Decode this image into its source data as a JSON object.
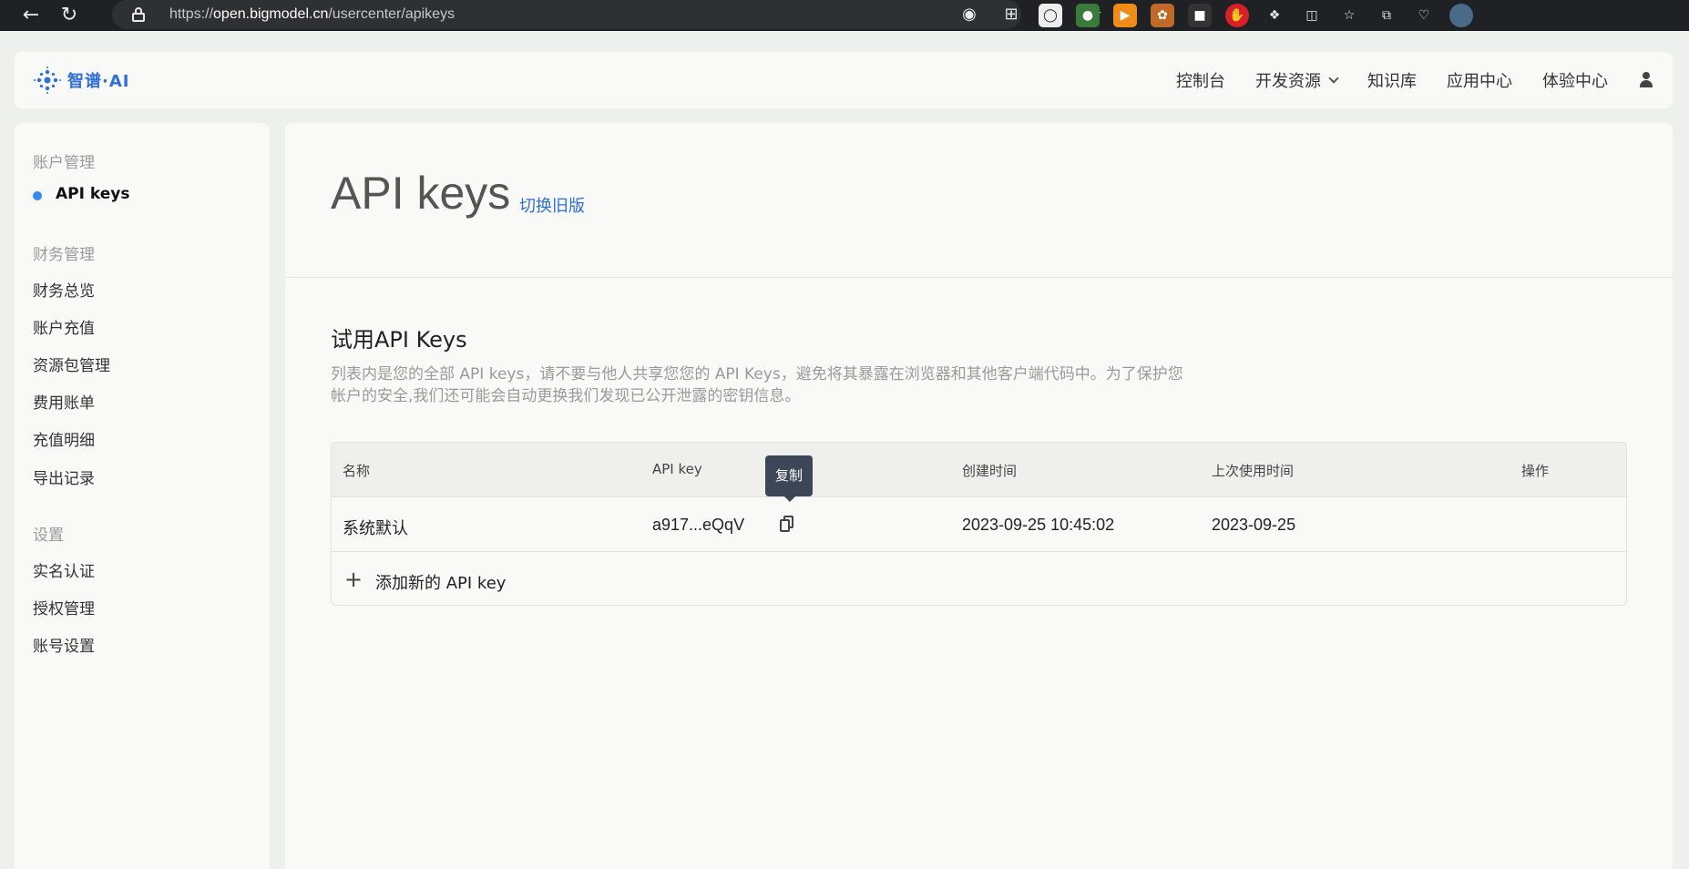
{
  "browser": {
    "url_prefix": "https://",
    "url_host": "open.bigmodel.cn",
    "url_path": "/usercenter/apikeys"
  },
  "header": {
    "logo_text": "智谱·AI",
    "nav": [
      {
        "label": "控制台"
      },
      {
        "label": "开发资源"
      },
      {
        "label": "知识库"
      },
      {
        "label": "应用中心"
      },
      {
        "label": "体验中心"
      }
    ]
  },
  "sidebar": {
    "groups": [
      {
        "title": "账户管理",
        "items": [
          "API keys"
        ]
      },
      {
        "title": "财务管理",
        "items": [
          "财务总览",
          "账户充值",
          "资源包管理",
          "费用账单",
          "充值明细",
          "导出记录"
        ]
      },
      {
        "title": "设置",
        "items": [
          "实名认证",
          "授权管理",
          "账号设置"
        ]
      }
    ]
  },
  "main": {
    "title": "API keys",
    "switch_link": "切换旧版",
    "section_title": "试用API Keys",
    "section_desc": "列表内是您的全部 API keys，请不要与他人共享您您的 API Keys，避免将其暴露在浏览器和其他客户端代码中。为了保护您帐户的安全,我们还可能会自动更换我们发现已公开泄露的密钥信息。",
    "table": {
      "headers": [
        "名称",
        "API key",
        "创建时间",
        "上次使用时间",
        "操作"
      ],
      "rows": [
        {
          "name": "系统默认",
          "api_key": "a917...eQqV",
          "created": "2023-09-25 10:45:02",
          "last_used": "2023-09-25"
        }
      ],
      "add_label": "添加新的 API key"
    },
    "tooltip": "复制"
  },
  "colors": {
    "accent": "#2e6fd9",
    "active_dot": "#2f8cf0",
    "tooltip_bg": "#3c4656"
  }
}
